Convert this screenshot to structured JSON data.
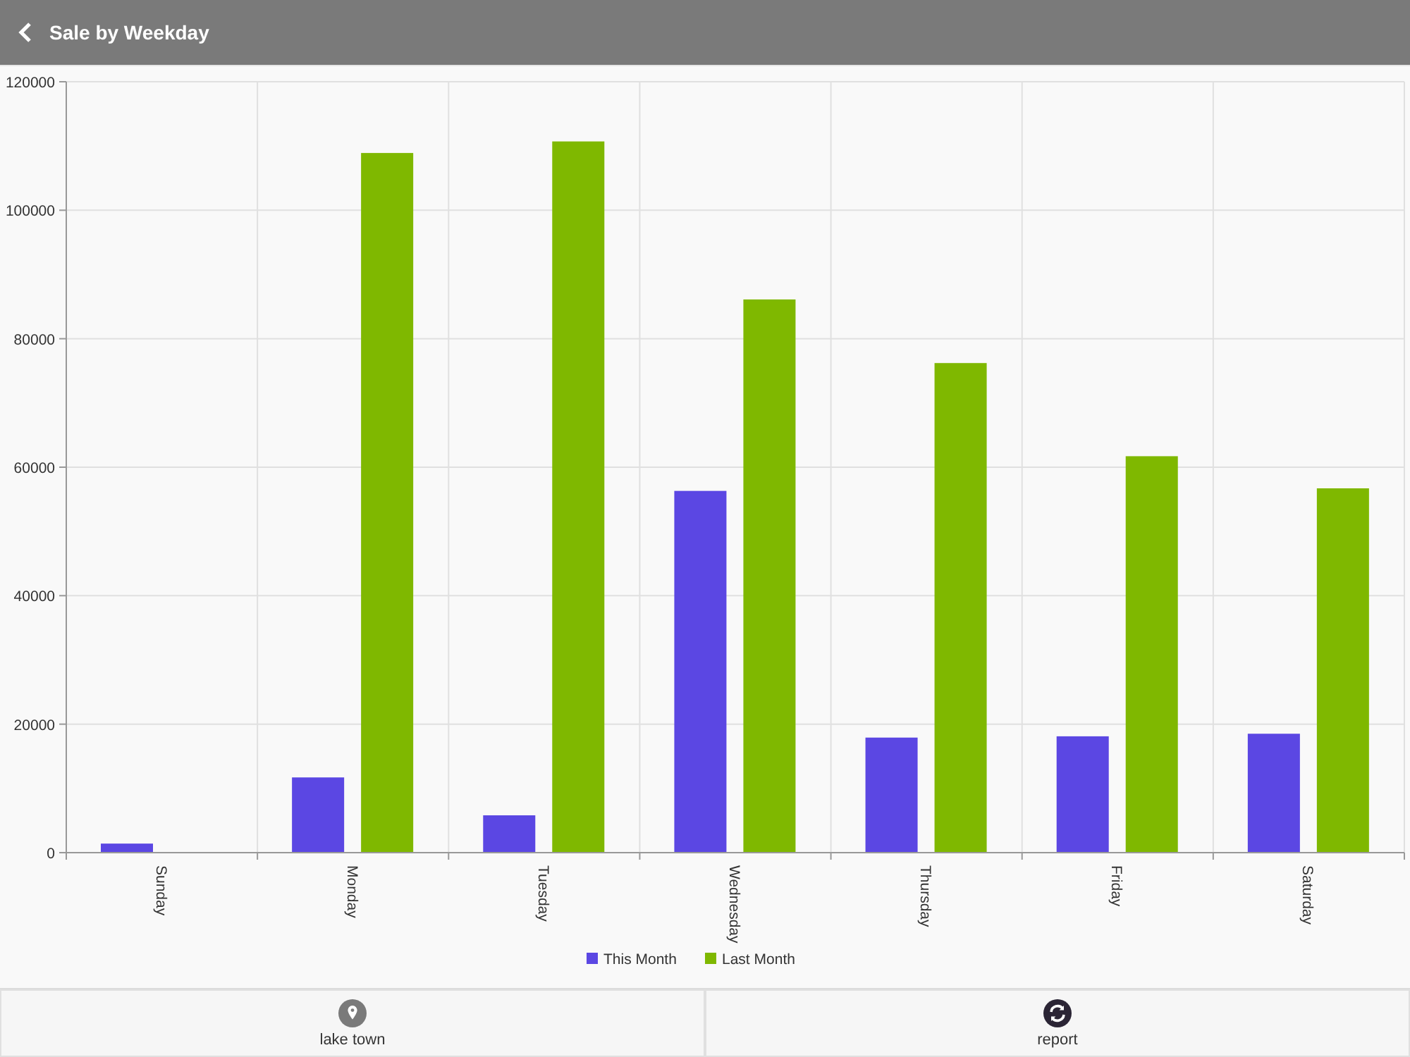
{
  "header": {
    "title": "Sale by Weekday"
  },
  "chart_data": {
    "type": "bar",
    "categories": [
      "Sunday",
      "Monday",
      "Tuesday",
      "Wednesday",
      "Thursday",
      "Friday",
      "Saturday"
    ],
    "series": [
      {
        "name": "This Month",
        "color": "#5b47e3",
        "values": [
          1300,
          11600,
          5700,
          56200,
          17800,
          18000,
          18400
        ]
      },
      {
        "name": "Last Month",
        "color": "#7fb800",
        "values": [
          0,
          108800,
          110600,
          86000,
          76100,
          61600,
          56600
        ]
      }
    ],
    "grid": true,
    "legend": true,
    "ylim": [
      0,
      120000
    ],
    "yticks": [
      0,
      20000,
      40000,
      60000,
      80000,
      100000,
      120000
    ]
  },
  "footer": [
    {
      "kind": "location",
      "label": "lake town"
    },
    {
      "kind": "refresh",
      "label": "report"
    }
  ]
}
